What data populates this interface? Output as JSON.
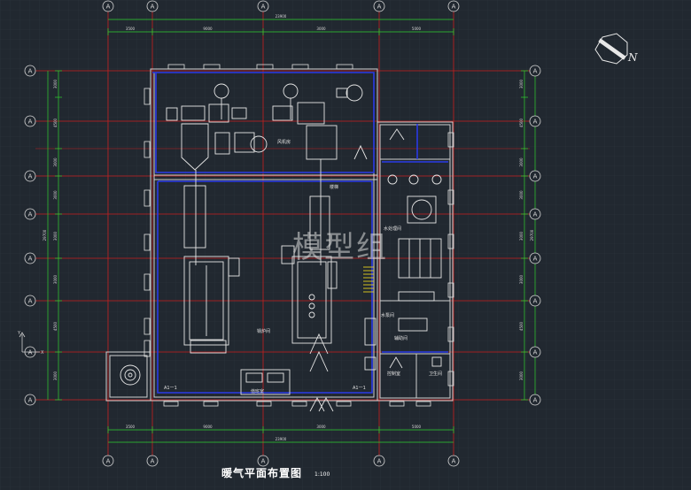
{
  "drawing": {
    "title": "暖气平面布置图",
    "scale": "1:100",
    "watermark": "模型组",
    "north_label": "N"
  },
  "axes": {
    "column_labels": [
      "A",
      "A",
      "A",
      "A",
      "A"
    ],
    "row_labels": [
      "A",
      "A",
      "A",
      "A",
      "A",
      "A",
      "A",
      "A",
      "A"
    ]
  },
  "dimensions": {
    "top_total": "23900",
    "bottom_total": "23900",
    "top_segments": [
      "3500",
      "9000",
      "3000",
      "5000"
    ],
    "bottom_segments": [
      "3500",
      "9000",
      "3000",
      "5000"
    ],
    "left_total": "29700",
    "right_total": "29700",
    "side_segments": [
      "3000",
      "4500",
      "3000",
      "3000",
      "3000",
      "3000",
      "4500",
      "3000"
    ]
  },
  "rooms": {
    "fan_room": "风机房",
    "boiler_room": "锅炉间",
    "control_room": "控制室",
    "water_room": "水处理间",
    "pump_room": "水泵间",
    "aux_room": "辅助间",
    "toilet": "卫生间",
    "duty_room": "值班室",
    "stair_note": "楼梯",
    "section_a": "A1一1",
    "section_b": "A1一1"
  },
  "colors": {
    "background": "#212830",
    "grid": "#2e3740",
    "axis_line": "#c81e1e",
    "dimension": "#2fd12f",
    "wall": "#d0d0d0",
    "pipe": "#2233dd",
    "equipment": "#e6e6e6",
    "stair": "#e6d21e"
  }
}
